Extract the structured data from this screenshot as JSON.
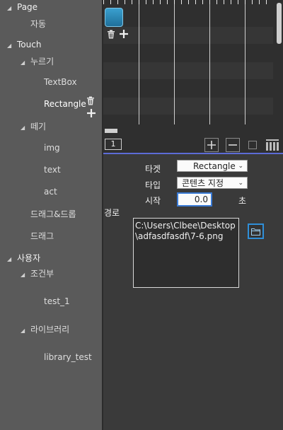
{
  "tree": {
    "page": "Page",
    "auto": "자동",
    "touch": "Touch",
    "press": "누르기",
    "textbox": "TextBox",
    "rectangle": "Rectangle",
    "swipe": "떼기",
    "img": "img",
    "text": "text",
    "act": "act",
    "dragdrop": "드래그&드롭",
    "drag": "드래그",
    "user": "사용자",
    "condition": "조건부",
    "test1": "test_1",
    "library": "라이브러리",
    "library_test": "library_test"
  },
  "timeline": {
    "page_number": "1"
  },
  "props": {
    "target_label": "타겟",
    "target_value": "Rectangle",
    "type_label": "타입",
    "type_value": "콘텐츠 지정",
    "start_label": "시작",
    "start_value": "0.0",
    "seconds_unit": "초",
    "path_label": "경로",
    "path_value": "C:\\Users\\Clbee\\Desktop\n\\adfasdfasdf\\7-6.png"
  },
  "colors": {
    "tree_bg": "#5a5a5a",
    "timeline_bg": "#2f2f2f",
    "panel_bg": "#3a3a3a",
    "accent_line": "#5c6bd6",
    "focus_border": "#3a7bd5"
  }
}
